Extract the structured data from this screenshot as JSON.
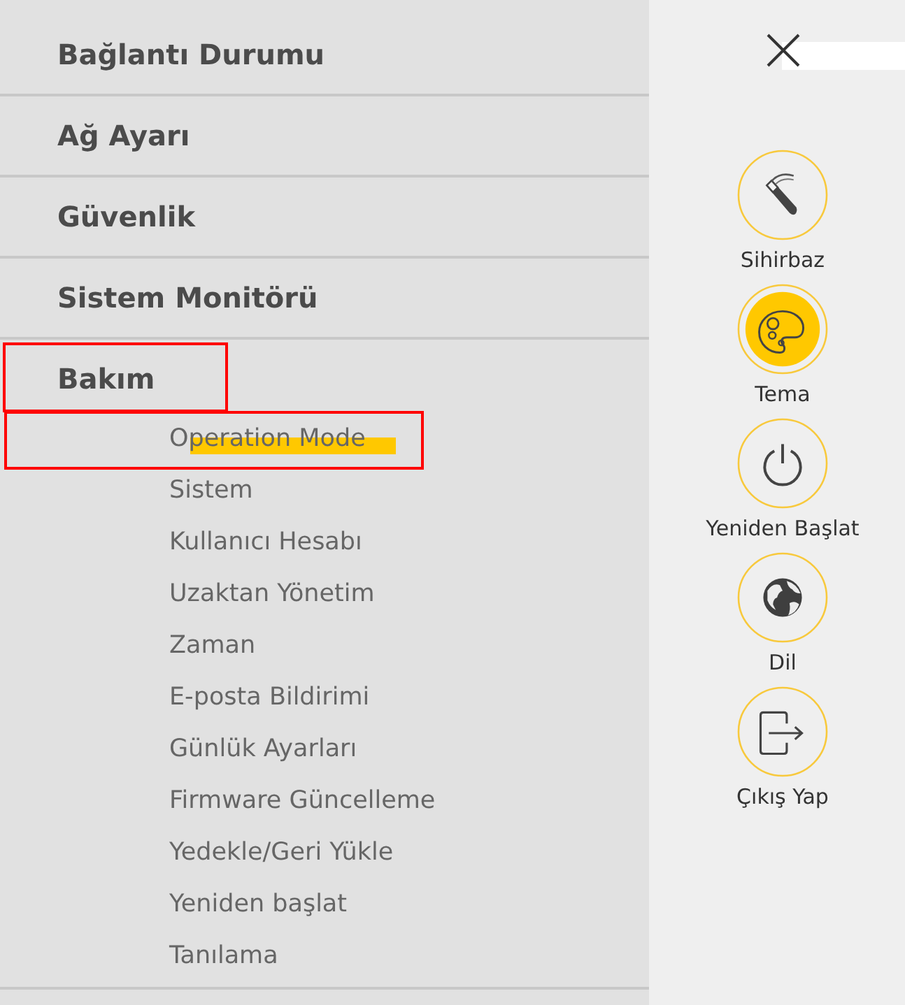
{
  "menu": [
    {
      "label": "Bağlantı Durumu",
      "outlined": false
    },
    {
      "label": "Ağ Ayarı",
      "outlined": false
    },
    {
      "label": "Güvenlik",
      "outlined": false
    },
    {
      "label": "Sistem Monitörü",
      "outlined": false
    },
    {
      "label": "Bakım",
      "outlined": true,
      "children": [
        {
          "label": "Operation Mode",
          "outlined": true,
          "marked": true
        },
        {
          "label": "Sistem",
          "outlined": false,
          "marked": false
        },
        {
          "label": "Kullanıcı Hesabı",
          "outlined": false,
          "marked": false
        },
        {
          "label": "Uzaktan Yönetim",
          "outlined": false,
          "marked": false
        },
        {
          "label": "Zaman",
          "outlined": false,
          "marked": false
        },
        {
          "label": "E-posta Bildirimi",
          "outlined": false,
          "marked": false
        },
        {
          "label": "Günlük Ayarları",
          "outlined": false,
          "marked": false
        },
        {
          "label": "Firmware Güncelleme",
          "outlined": false,
          "marked": false
        },
        {
          "label": "Yedekle/Geri Yükle",
          "outlined": false,
          "marked": false
        },
        {
          "label": "Yeniden başlat",
          "outlined": false,
          "marked": false
        },
        {
          "label": "Tanılama",
          "outlined": false,
          "marked": false
        }
      ]
    }
  ],
  "shortcuts": [
    {
      "kind": "wizard",
      "label": "Sihirbaz",
      "selected": false
    },
    {
      "kind": "theme",
      "label": "Tema",
      "selected": true
    },
    {
      "kind": "restart",
      "label": "Yeniden Başlat",
      "selected": false
    },
    {
      "kind": "language",
      "label": "Dil",
      "selected": false
    },
    {
      "kind": "logout",
      "label": "Çıkış Yap",
      "selected": false
    }
  ]
}
